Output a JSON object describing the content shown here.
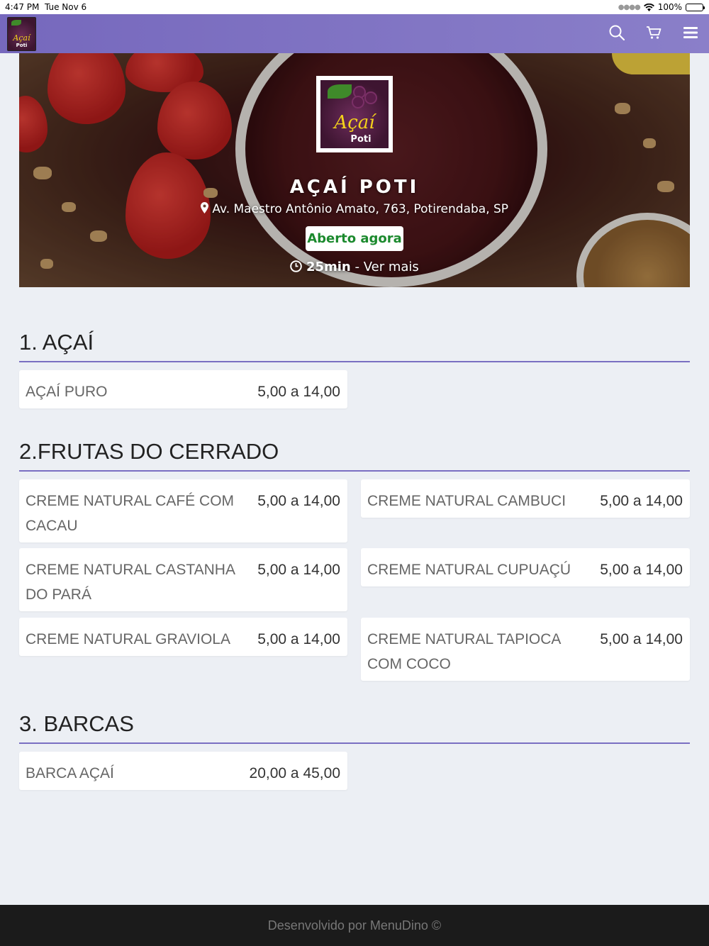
{
  "status_bar": {
    "time": "4:47 PM",
    "date": "Tue Nov 6",
    "battery": "100%"
  },
  "navbar": {
    "logo_text": "Açaí",
    "logo_subtext": "Poti",
    "icons": [
      "search-icon",
      "cart-icon",
      "menu-icon"
    ],
    "background": "#7b6fc3"
  },
  "store": {
    "logo_text": "Açaí",
    "logo_subtext": "Poti",
    "name": "AÇAÍ POTI",
    "address": "Av. Maestro Antônio Amato, 763, Potirendaba, SP",
    "status": "Aberto agora",
    "status_color": "#1c8a2e",
    "delivery_time": "25min",
    "separator": " - ",
    "more_link": "Ver mais"
  },
  "sections": [
    {
      "title": "1. AÇAÍ",
      "items": [
        {
          "name": "AÇAÍ PURO",
          "price": "5,00 a 14,00"
        }
      ]
    },
    {
      "title": "2.FRUTAS DO CERRADO",
      "items": [
        {
          "name": "CREME NATURAL CAFÉ COM CACAU",
          "price": "5,00 a 14,00"
        },
        {
          "name": "CREME NATURAL CAMBUCI",
          "price": "5,00 a 14,00"
        },
        {
          "name": "CREME NATURAL CASTANHA DO PARÁ",
          "price": "5,00 a 14,00"
        },
        {
          "name": "CREME NATURAL CUPUAÇÚ",
          "price": "5,00 a 14,00"
        },
        {
          "name": "CREME NATURAL GRAVIOLA",
          "price": "5,00 a 14,00"
        },
        {
          "name": "CREME NATURAL TAPIOCA COM COCO",
          "price": "5,00 a 14,00"
        }
      ]
    },
    {
      "title": "3. BARCAS",
      "items": [
        {
          "name": "BARCA AÇAÍ",
          "price": "20,00 a 45,00"
        }
      ]
    }
  ],
  "footer": {
    "text": "Desenvolvido por MenuDino ©"
  }
}
